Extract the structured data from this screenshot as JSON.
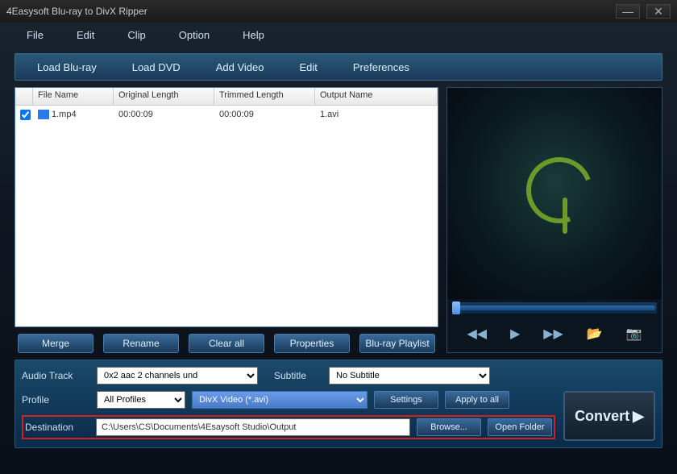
{
  "title": "4Easysoft Blu-ray to DivX Ripper",
  "menubar": [
    "File",
    "Edit",
    "Clip",
    "Option",
    "Help"
  ],
  "toolbar": [
    "Load Blu-ray",
    "Load DVD",
    "Add Video",
    "Edit",
    "Preferences"
  ],
  "columns": {
    "name": "File Name",
    "orig": "Original Length",
    "trim": "Trimmed Length",
    "out": "Output Name"
  },
  "files": [
    {
      "checked": true,
      "name": "1.mp4",
      "orig": "00:00:09",
      "trim": "00:00:09",
      "out": "1.avi"
    }
  ],
  "actions": [
    "Merge",
    "Rename",
    "Clear all",
    "Properties",
    "Blu-ray Playlist"
  ],
  "audio_track": {
    "label": "Audio Track",
    "value": "0x2 aac 2 channels und"
  },
  "subtitle": {
    "label": "Subtitle",
    "value": "No Subtitle"
  },
  "profile": {
    "label": "Profile",
    "category": "All Profiles",
    "value": "DivX Video (*.avi)"
  },
  "settings_btn": "Settings",
  "apply_btn": "Apply to all",
  "destination": {
    "label": "Destination",
    "value": "C:\\Users\\CS\\Documents\\4Esaysoft Studio\\Output"
  },
  "browse_btn": "Browse...",
  "open_folder_btn": "Open Folder",
  "convert_btn": "Convert"
}
